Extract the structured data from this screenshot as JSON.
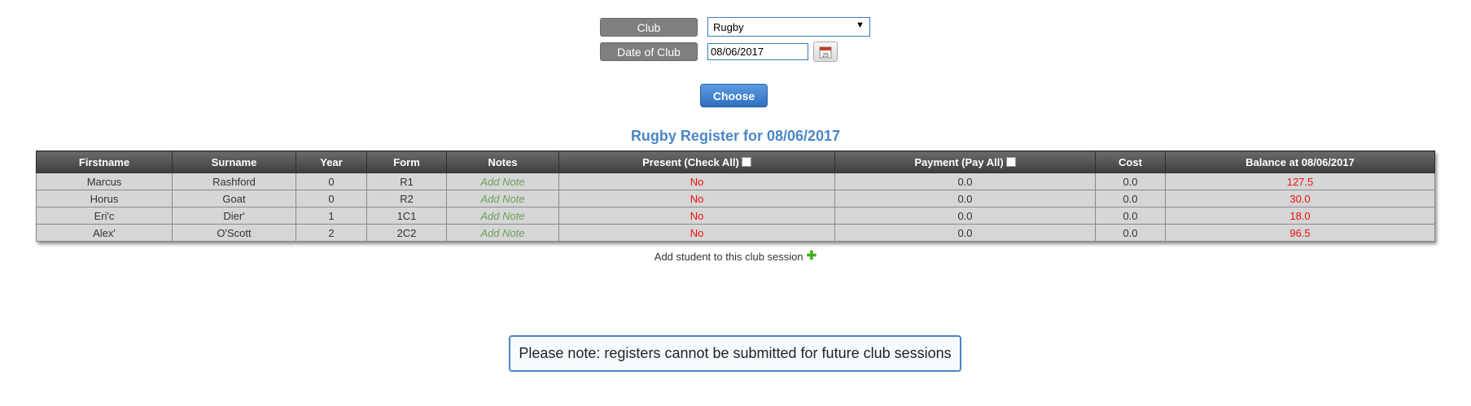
{
  "filters": {
    "club_label": "Club",
    "club_value": "Rugby",
    "date_label": "Date of Club",
    "date_value": "08/06/2017",
    "calendar_day": "25",
    "choose_label": "Choose"
  },
  "register": {
    "title": "Rugby Register for 08/06/2017",
    "columns": [
      "Firstname",
      "Surname",
      "Year",
      "Form",
      "Notes",
      "Present (Check All)",
      "Payment (Pay All)",
      "Cost",
      "Balance at 08/06/2017"
    ],
    "rows": [
      {
        "firstname": "Marcus",
        "surname": "Rashford",
        "year": "0",
        "form": "R1",
        "notes": "Add Note",
        "present": "No",
        "payment": "0.0",
        "cost": "0.0",
        "balance": "127.5"
      },
      {
        "firstname": "Horus",
        "surname": "Goat",
        "year": "0",
        "form": "R2",
        "notes": "Add Note",
        "present": "No",
        "payment": "0.0",
        "cost": "0.0",
        "balance": "30.0"
      },
      {
        "firstname": "Eri'c",
        "surname": "Dier'",
        "year": "1",
        "form": "1C1",
        "notes": "Add Note",
        "present": "No",
        "payment": "0.0",
        "cost": "0.0",
        "balance": "18.0"
      },
      {
        "firstname": "Alex'",
        "surname": "O'Scott",
        "year": "2",
        "form": "2C2",
        "notes": "Add Note",
        "present": "No",
        "payment": "0.0",
        "cost": "0.0",
        "balance": "96.5"
      }
    ]
  },
  "add_student_label": "Add student to this club session",
  "notice": "Please note: registers cannot be submitted for future club sessions",
  "colors": {
    "accent": "#4a86c8",
    "negative": "#ee1111",
    "note_link": "#6ba25c",
    "add_icon": "#3fb21b"
  }
}
